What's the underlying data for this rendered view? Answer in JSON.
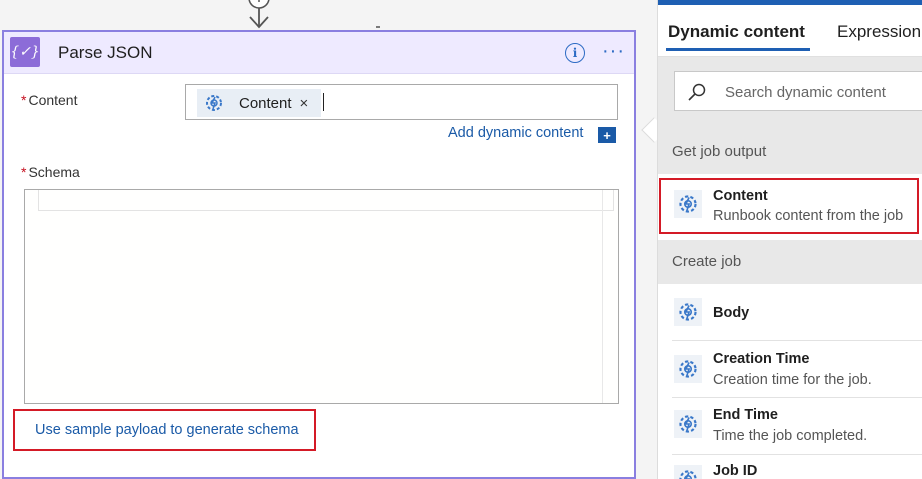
{
  "card": {
    "title": "Parse JSON",
    "icon": "parse-json-icon",
    "accent": "#8c6cd8",
    "content_label": "Content",
    "content_token": "Content",
    "add_dynamic_label": "Add dynamic content",
    "add_dynamic_symbol": "+",
    "schema_label": "Schema",
    "sample_payload_link": "Use sample payload to generate schema"
  },
  "pane": {
    "tabs": [
      {
        "label": "Dynamic content",
        "active": true
      },
      {
        "label": "Expression",
        "active": false
      }
    ],
    "search": {
      "placeholder": "Search dynamic content",
      "value": ""
    },
    "groups": [
      {
        "title": "Get job output",
        "items": [
          {
            "title": "Content",
            "description": "Runbook content from the job"
          }
        ]
      },
      {
        "title": "Create job",
        "items": [
          {
            "title": "Body",
            "description": ""
          },
          {
            "title": "Creation Time",
            "description": "Creation time for the job."
          },
          {
            "title": "End Time",
            "description": "Time the job completed."
          },
          {
            "title": "Job ID",
            "description": ""
          }
        ]
      }
    ]
  },
  "colors": {
    "link": "#1a5aa7",
    "highlight": "#d41a26",
    "card_border": "#8a7fe0"
  }
}
